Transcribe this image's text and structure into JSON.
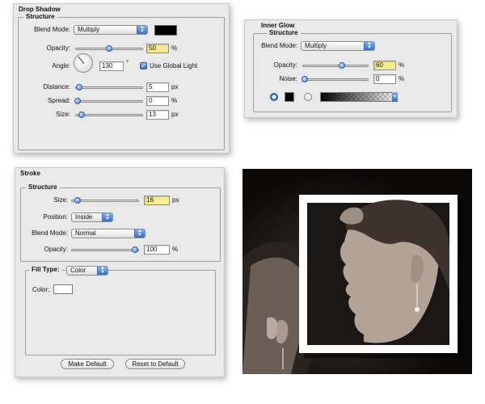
{
  "drop_shadow": {
    "title": "Drop Shadow",
    "structure": "Structure",
    "blend_mode_label": "Blend Mode:",
    "blend_mode_value": "Multiply",
    "shadow_color": "#000000",
    "opacity_label": "Opacity:",
    "opacity_value": "50",
    "opacity_unit": "%",
    "angle_label": "Angle:",
    "angle_value": "130",
    "angle_unit": "°",
    "global_light_label": "Use Global Light",
    "distance_label": "Distance:",
    "distance_value": "5",
    "distance_unit": "px",
    "spread_label": "Spread:",
    "spread_value": "0",
    "spread_unit": "%",
    "size_label": "Size:",
    "size_value": "13",
    "size_unit": "px"
  },
  "inner_glow": {
    "title": "Inner Glow",
    "structure": "Structure",
    "blend_mode_label": "Blend Mode:",
    "blend_mode_value": "Multiply",
    "opacity_label": "Opacity:",
    "opacity_value": "60",
    "opacity_unit": "%",
    "noise_label": "Noise:",
    "noise_value": "0",
    "noise_unit": "%",
    "glow_color": "#000000"
  },
  "stroke": {
    "title": "Stroke",
    "structure": "Structure",
    "size_label": "Size:",
    "size_value": "16",
    "size_unit": "px",
    "position_label": "Position:",
    "position_value": "Inside",
    "blend_mode_label": "Blend Mode:",
    "blend_mode_value": "Normal",
    "opacity_label": "Opacity:",
    "opacity_value": "100",
    "opacity_unit": "%",
    "fill_type_label": "Fill Type:",
    "fill_type_value": "Color",
    "color_label": "Color:",
    "stroke_color": "#ffffff",
    "make_default": "Make Default",
    "reset_default": "Reset to Default"
  }
}
